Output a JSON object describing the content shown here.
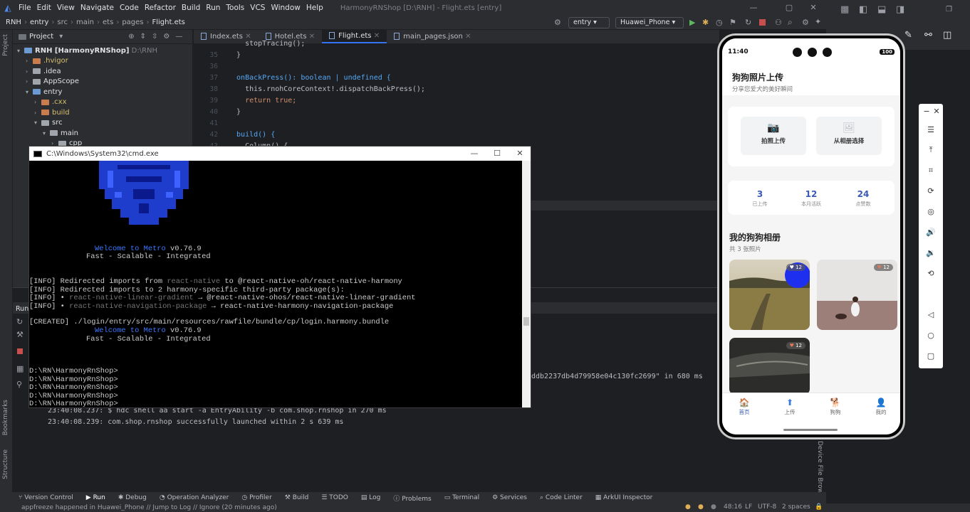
{
  "titlebar": {
    "menu": [
      "File",
      "Edit",
      "View",
      "Navigate",
      "Code",
      "Refactor",
      "Build",
      "Run",
      "Tools",
      "VCS",
      "Window",
      "Help"
    ],
    "title": "HarmonyRNShop [D:\\RNH] - Flight.ets [entry]"
  },
  "navbar": {
    "crumbs": [
      "RNH",
      "entry",
      "src",
      "main",
      "ets",
      "pages",
      "Flight.ets"
    ],
    "module": "entry",
    "device": "Huawei_Phone"
  },
  "project": {
    "header": "Project",
    "root": "RNH [HarmonyRNShop]",
    "root_path": "D:\\RNH",
    "items": [
      ".hvigor",
      ".idea",
      "AppScope",
      "entry",
      ".cxx",
      "build",
      "src",
      "main",
      "cpp"
    ]
  },
  "editor": {
    "tabs": [
      "Index.ets",
      "Hotel.ets",
      "Flight.ets",
      "main_pages.json"
    ],
    "active_tab": "Flight.ets",
    "line_numbers": [
      "35",
      "36",
      "37",
      "38",
      "39",
      "40",
      "41",
      "42",
      "43"
    ],
    "lines": [
      "    stopTracing();",
      "  }",
      "",
      "  onBackPress(): boolean | undefined {",
      "    this.rnohCoreContext!.dispatchBackPress();",
      "    return true;",
      "  }",
      "",
      "  build() {",
      "    Column() {"
    ]
  },
  "cmd": {
    "title": "C:\\Windows\\System32\\cmd.exe",
    "welcome_prefix": "Welcome to ",
    "welcome_word": "Metro",
    "version": " v0.76.9",
    "tagline": "Fast - Scalable - Integrated",
    "info1_a": "[INFO] Redirected imports from ",
    "info1_b": "react-native",
    "info1_c": " to @react-native-oh/react-native-harmony",
    "info2": "[INFO] Redirected imports to 2 harmony-specific third-party package(s):",
    "info3_a": "[INFO] • ",
    "info3_b": "react-native-linear-gradient",
    "info3_c": " → @react-native-ohos/react-native-linear-gradient",
    "info4_a": "[INFO] • ",
    "info4_b": "react-native-navigation-package",
    "info4_c": " → react-native-harmony-navigation-package",
    "created": "[CREATED] ./login/entry/src/main/resources/rawfile/bundle/cp/login.harmony.bundle",
    "prompts": [
      "D:\\RN\\HarmonyRnShop>",
      "D:\\RN\\HarmonyRnShop>",
      "D:\\RN\\HarmonyRnShop>",
      "D:\\RN\\HarmonyRnShop>",
      "D:\\RN\\HarmonyRnShop>"
    ]
  },
  "run": {
    "label": "Run:",
    "partial": "ddb2237db4d79958e04c130fc2699\" in 680 ms",
    "line1": "23:40:08.237: $ hdc shell aa start -a EntryAbility -b com.shop.rnshop in 270 ms",
    "line2": "23:40:08.239: com.shop.rnshop successfully launched within 2 s 639 ms"
  },
  "phone": {
    "time": "11:40",
    "battery": "100",
    "title": "狗狗照片上传",
    "subtitle": "分享您爱犬的美好瞬间",
    "btn_camera": "拍照上传",
    "btn_album": "从相册选择",
    "stats": [
      {
        "num": "3",
        "label": "已上传"
      },
      {
        "num": "12",
        "label": "本月活跃"
      },
      {
        "num": "24",
        "label": "点赞数"
      }
    ],
    "album_title": "我的狗狗相册",
    "album_count": "共 3 张照片",
    "likes": [
      "12",
      "12",
      "12"
    ],
    "tabs": [
      "首页",
      "上传",
      "狗狗",
      "我的"
    ]
  },
  "bottom_tools": [
    "Version Control",
    "Run",
    "Debug",
    "Operation Analyzer",
    "Profiler",
    "Build",
    "TODO",
    "Log",
    "Problems",
    "Terminal",
    "Services",
    "Code Linter",
    "ArkUI Inspector"
  ],
  "statusbar": {
    "message": "appfreeze happened in Huawei_Phone // Jump to Log // Ignore (20 minutes ago)",
    "position": "48:16",
    "lf": "LF",
    "encoding": "UTF-8",
    "indent": "2 spaces"
  },
  "side_labels": {
    "project": "Project",
    "bookmarks": "Bookmarks",
    "structure": "Structure",
    "device_file_browser": "Device File Browser"
  }
}
